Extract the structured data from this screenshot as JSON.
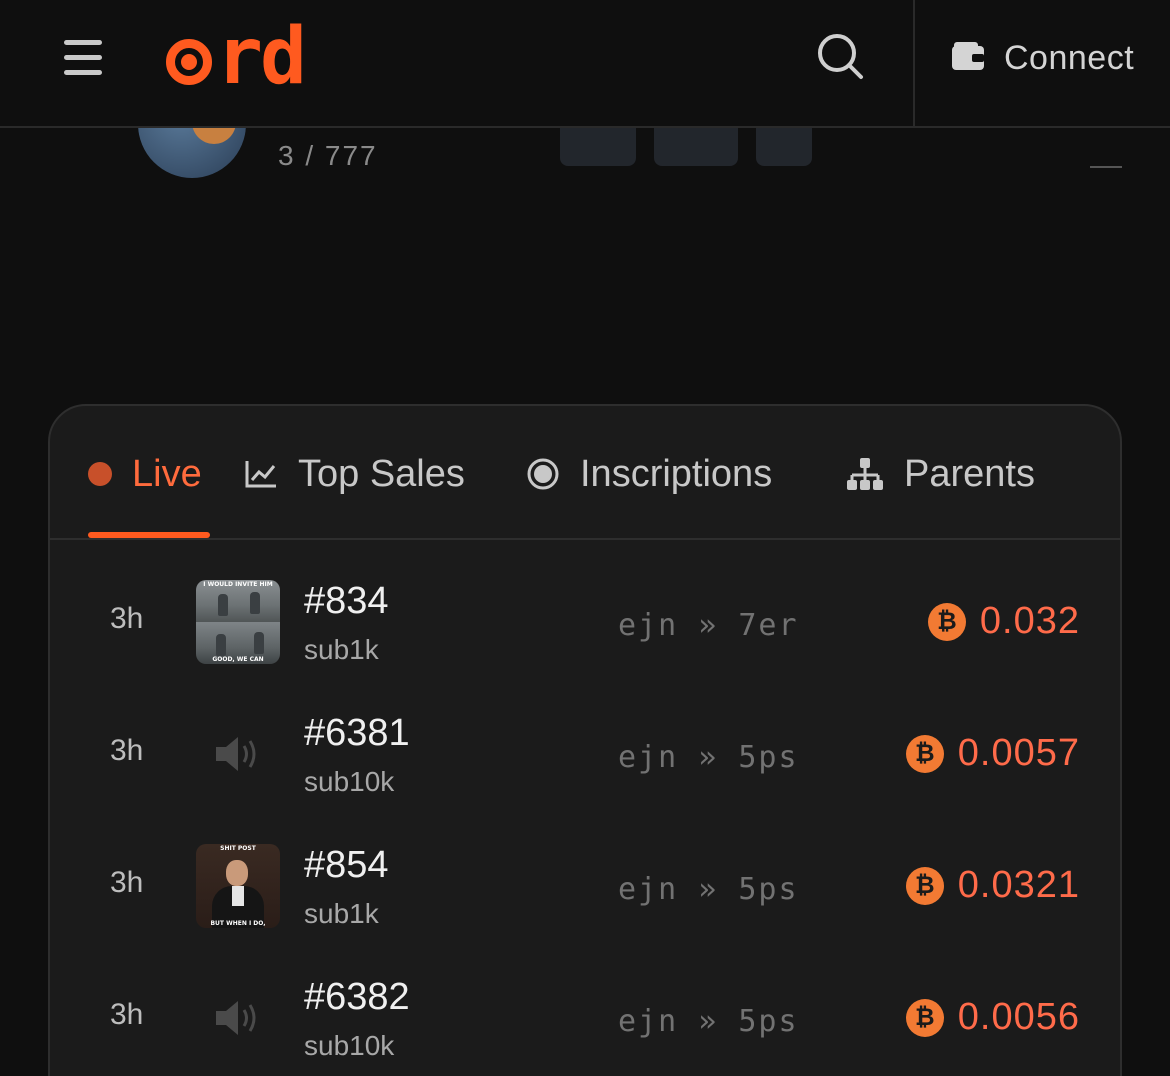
{
  "header": {
    "logo_text": "rd",
    "connect_label": "Connect",
    "icons": {
      "menu": "hamburger-menu-icon",
      "search": "search-icon",
      "wallet": "wallet-icon"
    }
  },
  "peek": {
    "count": "3 / 777"
  },
  "tabs": [
    {
      "label": "Live",
      "icon": "live-dot-icon",
      "active": true
    },
    {
      "label": "Top Sales",
      "icon": "chart-line-icon",
      "active": false
    },
    {
      "label": "Inscriptions",
      "icon": "radio-dot-icon",
      "active": false
    },
    {
      "label": "Parents",
      "icon": "hierarchy-icon",
      "active": false
    }
  ],
  "sales": [
    {
      "time": "3h",
      "media": "image",
      "number": "#834",
      "sub": "sub1k",
      "from": "ejn",
      "to": "7er",
      "price": "0.032"
    },
    {
      "time": "3h",
      "media": "audio",
      "number": "#6381",
      "sub": "sub10k",
      "from": "ejn",
      "to": "5ps",
      "price": "0.0057"
    },
    {
      "time": "3h",
      "media": "image",
      "number": "#854",
      "sub": "sub1k",
      "from": "ejn",
      "to": "5ps",
      "price": "0.0321"
    },
    {
      "time": "3h",
      "media": "audio",
      "number": "#6382",
      "sub": "sub10k",
      "from": "ejn",
      "to": "5ps",
      "price": "0.0056"
    }
  ],
  "meme_834": {
    "top_caption": "I WOULD INVITE HIM",
    "bottom_caption": "GOOD, WE CAN"
  },
  "meme_854": {
    "top_caption": "SHIT POST",
    "bottom_caption": "BUT WHEN I DO,"
  },
  "currency_symbol": "₿",
  "transfer_separator": "»",
  "colors": {
    "accent": "#ff5a1f",
    "price": "#ff6b4a",
    "background": "#0f0f0f",
    "card": "#1b1b1b"
  }
}
